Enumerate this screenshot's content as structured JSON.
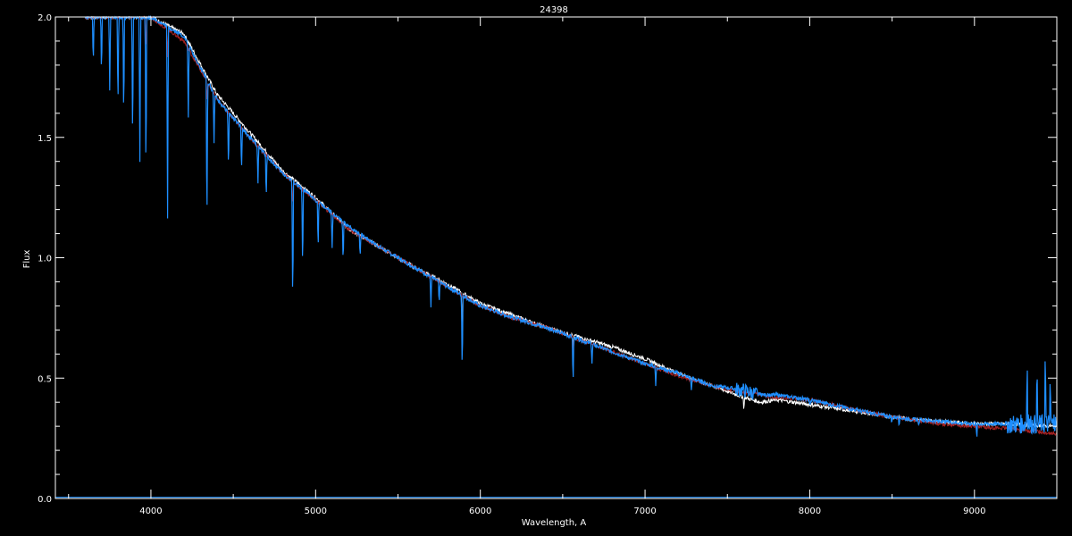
{
  "chart_data": {
    "type": "line",
    "title": "24398",
    "xlabel": "Wavelength, A",
    "ylabel": "Flux",
    "xlim": [
      3420,
      9500
    ],
    "ylim": [
      0.0,
      2.0
    ],
    "x_ticks": [
      4000,
      5000,
      6000,
      7000,
      8000,
      9000
    ],
    "y_ticks": [
      0.0,
      0.5,
      1.0,
      1.5,
      2.0
    ],
    "x_tick_labels": [
      "4000",
      "5000",
      "6000",
      "7000",
      "8000",
      "9000"
    ],
    "y_tick_labels": [
      "0.0",
      "0.5",
      "1.0",
      "1.5",
      "2.0"
    ],
    "grid": false,
    "background": "#000000",
    "series": [
      {
        "color": "#ffffff",
        "x": [
          3600,
          3800,
          4000,
          4200,
          4400,
          4600,
          4800,
          5000,
          5200,
          5400,
          5600,
          5800,
          6000,
          6200,
          6400,
          6600,
          6800,
          7000,
          7200,
          7400,
          7600,
          7700,
          7800,
          8000,
          8200,
          8400,
          8600,
          8800,
          9000,
          9200,
          9500
        ],
        "y": [
          2.0,
          2.0,
          2.0,
          1.93,
          1.68,
          1.52,
          1.36,
          1.25,
          1.12,
          1.04,
          0.96,
          0.89,
          0.81,
          0.76,
          0.71,
          0.67,
          0.63,
          0.58,
          0.52,
          0.47,
          0.42,
          0.4,
          0.41,
          0.39,
          0.37,
          0.35,
          0.33,
          0.32,
          0.31,
          0.31,
          0.3
        ],
        "spikes": [
          {
            "x": 5890,
            "depth": 0.22
          },
          {
            "x": 6563,
            "depth": 0.12
          },
          {
            "x": 7600,
            "depth": 0.05
          }
        ]
      },
      {
        "color": "#aa2222",
        "x": [
          3600,
          3800,
          4000,
          4200,
          4400,
          4600,
          4800,
          5000,
          5200,
          5400,
          5600,
          5800,
          6000,
          6200,
          6400,
          6600,
          6800,
          7000,
          7200,
          7400,
          7600,
          7800,
          8000,
          8200,
          8400,
          8600,
          8800,
          9000,
          9200,
          9500
        ],
        "y": [
          2.0,
          2.0,
          2.0,
          1.9,
          1.66,
          1.5,
          1.35,
          1.24,
          1.12,
          1.04,
          0.96,
          0.88,
          0.8,
          0.75,
          0.71,
          0.66,
          0.61,
          0.56,
          0.51,
          0.47,
          0.44,
          0.42,
          0.41,
          0.38,
          0.35,
          0.33,
          0.31,
          0.3,
          0.29,
          0.27
        ],
        "spikes": [
          {
            "x": 3970,
            "depth": 0.15
          },
          {
            "x": 4101,
            "depth": 0.12
          },
          {
            "x": 4340,
            "depth": 0.1
          },
          {
            "x": 4861,
            "depth": 0.1
          },
          {
            "x": 6563,
            "depth": 0.08
          }
        ]
      },
      {
        "color": "#1e8fff",
        "x": [
          3600,
          3800,
          4000,
          4200,
          4400,
          4600,
          4800,
          5000,
          5200,
          5400,
          5600,
          5800,
          6000,
          6200,
          6400,
          6600,
          6800,
          7000,
          7200,
          7400,
          7600,
          7700,
          7800,
          8000,
          8200,
          8400,
          8600,
          8800,
          9000,
          9200,
          9400,
          9500
        ],
        "y": [
          2.0,
          2.0,
          2.0,
          1.92,
          1.66,
          1.5,
          1.35,
          1.24,
          1.13,
          1.04,
          0.96,
          0.88,
          0.8,
          0.75,
          0.71,
          0.66,
          0.61,
          0.56,
          0.52,
          0.47,
          0.45,
          0.43,
          0.43,
          0.41,
          0.38,
          0.35,
          0.33,
          0.32,
          0.31,
          0.31,
          0.31,
          0.31
        ],
        "spikes": [
          {
            "x": 3650,
            "depth": 0.2
          },
          {
            "x": 3700,
            "depth": 0.25
          },
          {
            "x": 3750,
            "depth": 0.3
          },
          {
            "x": 3800,
            "depth": 0.4
          },
          {
            "x": 3835,
            "depth": 0.45
          },
          {
            "x": 3889,
            "depth": 0.55
          },
          {
            "x": 3933,
            "depth": 0.6
          },
          {
            "x": 3970,
            "depth": 0.7
          },
          {
            "x": 4101,
            "depth": 0.8
          },
          {
            "x": 4227,
            "depth": 0.3
          },
          {
            "x": 4340,
            "depth": 0.65
          },
          {
            "x": 4383,
            "depth": 0.2
          },
          {
            "x": 4471,
            "depth": 0.25
          },
          {
            "x": 4550,
            "depth": 0.2
          },
          {
            "x": 4650,
            "depth": 0.15
          },
          {
            "x": 4700,
            "depth": 0.18
          },
          {
            "x": 4861,
            "depth": 0.55
          },
          {
            "x": 4921,
            "depth": 0.35
          },
          {
            "x": 5015,
            "depth": 0.2
          },
          {
            "x": 5100,
            "depth": 0.15
          },
          {
            "x": 5167,
            "depth": 0.18
          },
          {
            "x": 5270,
            "depth": 0.1
          },
          {
            "x": 5700,
            "depth": 0.12
          },
          {
            "x": 5750,
            "depth": 0.1
          },
          {
            "x": 5890,
            "depth": 0.33
          },
          {
            "x": 6563,
            "depth": 0.2
          },
          {
            "x": 6678,
            "depth": 0.08
          },
          {
            "x": 7065,
            "depth": 0.08
          },
          {
            "x": 7281,
            "depth": 0.05
          },
          {
            "x": 8000,
            "depth": 0.03
          },
          {
            "x": 8498,
            "depth": 0.03
          },
          {
            "x": 8542,
            "depth": 0.03
          },
          {
            "x": 8662,
            "depth": 0.03
          },
          {
            "x": 9014,
            "depth": 0.06
          }
        ],
        "upspikes": [
          {
            "x": 9320,
            "height": 0.3
          },
          {
            "x": 9380,
            "height": 0.25
          },
          {
            "x": 9430,
            "height": 0.34
          },
          {
            "x": 9460,
            "height": 0.22
          }
        ],
        "noisy": [
          {
            "from": 7550,
            "to": 7680,
            "amp": 0.03
          },
          {
            "from": 9200,
            "to": 9500,
            "amp": 0.04
          }
        ]
      }
    ]
  }
}
